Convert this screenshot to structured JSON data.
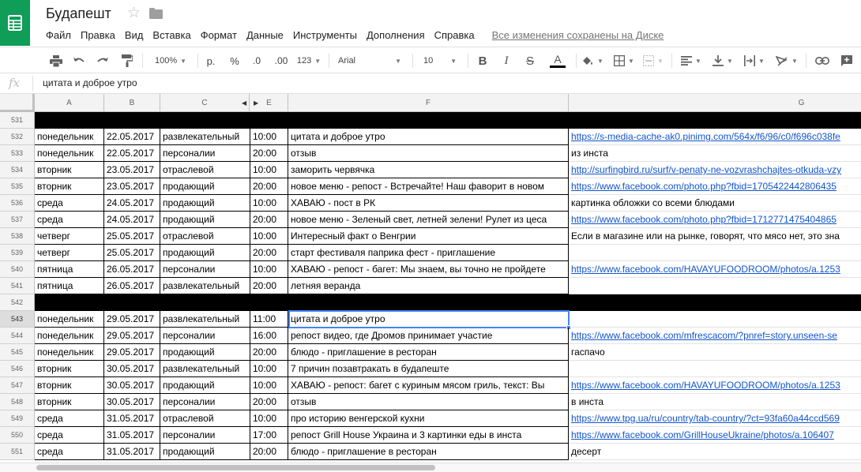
{
  "doc": {
    "title": "Будапешт"
  },
  "menu": [
    "Файл",
    "Правка",
    "Вид",
    "Вставка",
    "Формат",
    "Данные",
    "Инструменты",
    "Дополнения",
    "Справка"
  ],
  "save_status": "Все изменения сохранены на Диске",
  "toolbar": {
    "zoom": "100%",
    "currency": "р.",
    "percent": "%",
    "decrease_decimal": ".0",
    "increase_decimal": ".00",
    "more_formats": "123",
    "font": "Arial",
    "font_size": "10",
    "bold": "B",
    "italic": "I",
    "strike": "S",
    "text_color": "A",
    "text_color_value": "#000000"
  },
  "formula_bar": {
    "fx": "fx",
    "content": "цитата и доброе утро"
  },
  "colors": {
    "brand": "#0f9d58",
    "link": "#1155cc",
    "selection": "#4285f4"
  },
  "columns": [
    "A",
    "B",
    "C",
    "E",
    "F",
    "G"
  ],
  "rows": [
    {
      "num": "531",
      "separator": true
    },
    {
      "num": "532",
      "a": "понедельник",
      "b": "22.05.2017",
      "c": "развлекательный",
      "e": "10:00",
      "f": "цитата и доброе утро",
      "g": "https://s-media-cache-ak0.pinimg.com/564x/f6/96/c0/f696c038fe",
      "g_link": true
    },
    {
      "num": "533",
      "a": "понедельник",
      "b": "22.05.2017",
      "c": "персоналии",
      "e": "20:00",
      "f": "отзыв",
      "g": "из инста",
      "g_link": false
    },
    {
      "num": "534",
      "a": "вторник",
      "b": "23.05.2017",
      "c": "отраслевой",
      "e": "10:00",
      "f": "заморить червячка",
      "g": "http://surfingbird.ru/surf/v-penaty-ne-vozvrashchajtes-otkuda-vzy",
      "g_link": true
    },
    {
      "num": "535",
      "a": "вторник",
      "b": "23.05.2017",
      "c": "продающий",
      "e": "20:00",
      "f": "новое меню - репост - Встречайте! Наш фаворит в новом",
      "g": "https://www.facebook.com/photo.php?fbid=1705422442806435",
      "g_link": true
    },
    {
      "num": "536",
      "a": "среда",
      "b": "24.05.2017",
      "c": "продающий",
      "e": "10:00",
      "f": "ХАВАЮ - пост в РК",
      "g": "картинка обложки со всеми блюдами",
      "g_link": false
    },
    {
      "num": "537",
      "a": "среда",
      "b": "24.05.2017",
      "c": "продающий",
      "e": "20:00",
      "f": "новое меню - Зеленый свет, летней зелени! Рулет из цеса",
      "g": "https://www.facebook.com/photo.php?fbid=1712771475404865",
      "g_link": true
    },
    {
      "num": "538",
      "a": "четверг",
      "b": "25.05.2017",
      "c": "отраслевой",
      "e": "10:00",
      "f": "Интересный факт о Венгрии",
      "g": "Если в магазине или на рынке, говорят, что мясо нет, это зна",
      "g_link": false
    },
    {
      "num": "539",
      "a": "четверг",
      "b": "25.05.2017",
      "c": "продающий",
      "e": "20:00",
      "f": "старт фестиваля паприка фест - приглашение",
      "g": "",
      "g_link": false
    },
    {
      "num": "540",
      "a": "пятница",
      "b": "26.05.2017",
      "c": "персоналии",
      "e": "10:00",
      "f": "ХАВАЮ - репост - багет: Мы знаем, вы точно не пройдете",
      "g": "https://www.facebook.com/HAVAYUFOODROOM/photos/a.1253",
      "g_link": true
    },
    {
      "num": "541",
      "a": "пятница",
      "b": "26.05.2017",
      "c": "развлекательный",
      "e": "20:00",
      "f": "летняя веранда",
      "g": "",
      "g_link": false
    },
    {
      "num": "542",
      "separator": true
    },
    {
      "num": "543",
      "a": "понедельник",
      "b": "29.05.2017",
      "c": "развлекательный",
      "e": "11:00",
      "f": "цитата и доброе утро",
      "g": "",
      "g_link": false,
      "active": true
    },
    {
      "num": "544",
      "a": "понедельник",
      "b": "29.05.2017",
      "c": "персоналии",
      "e": "16:00",
      "f": "репост видео, где Дромов принимает участие",
      "g": "https://www.facebook.com/mfrescacom/?pnref=story.unseen-se",
      "g_link": true
    },
    {
      "num": "545",
      "a": "понедельник",
      "b": "29.05.2017",
      "c": "продающий",
      "e": "20:00",
      "f": "блюдо - приглашение в ресторан",
      "g": "гаспачо",
      "g_link": false
    },
    {
      "num": "546",
      "a": "вторник",
      "b": "30.05.2017",
      "c": "развлекательный",
      "e": "10:00",
      "f": "7 причин позавтракать в будапеште",
      "g": "",
      "g_link": false
    },
    {
      "num": "547",
      "a": "вторник",
      "b": "30.05.2017",
      "c": "продающий",
      "e": "10:00",
      "f": "ХАВАЮ - репост: багет с куриным мясом гриль, текст: Вы",
      "g": "https://www.facebook.com/HAVAYUFOODROOM/photos/a.1253",
      "g_link": true
    },
    {
      "num": "548",
      "a": "вторник",
      "b": "30.05.2017",
      "c": "персоналии",
      "e": "20:00",
      "f": "отзыв",
      "g": "в инста",
      "g_link": false
    },
    {
      "num": "549",
      "a": "среда",
      "b": "31.05.2017",
      "c": "отраслевой",
      "e": "10:00",
      "f": "про историю венгерской кухни",
      "g": "https://www.tpg.ua/ru/country/tab-country/?ct=93fa60a44ccd569",
      "g_link": true
    },
    {
      "num": "550",
      "a": "среда",
      "b": "31.05.2017",
      "c": "персоналии",
      "e": "17:00",
      "f": "репост  Grill House Украина и 3 картинки еды в инста",
      "g": "https://www.facebook.com/GrillHouseUkraine/photos/a.106407",
      "g_link": true
    },
    {
      "num": "551",
      "a": "среда",
      "b": "31.05.2017",
      "c": "продающий",
      "e": "20:00",
      "f": "блюдо - приглашение в ресторан",
      "g": "десерт",
      "g_link": false
    }
  ]
}
